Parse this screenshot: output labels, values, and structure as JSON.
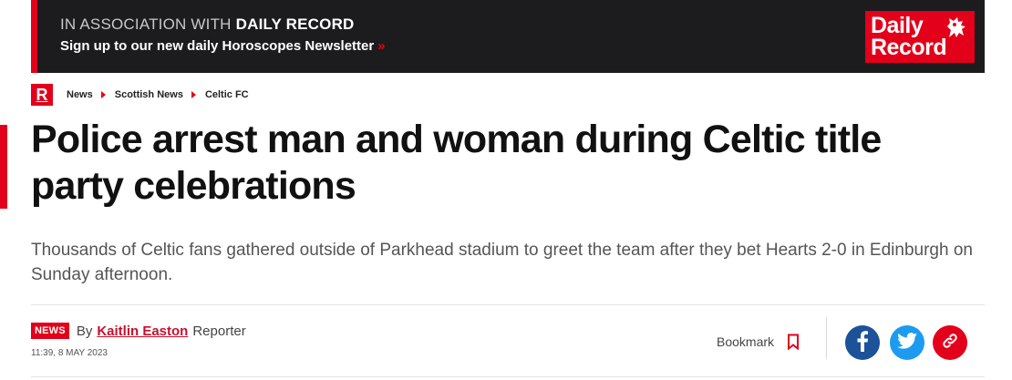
{
  "colors": {
    "brand_red": "#e2001a",
    "promo_bg": "#1c1c1e",
    "facebook": "#1b5298",
    "twitter": "#1d9bf0"
  },
  "promo": {
    "association_prefix": "IN ASSOCIATION WITH",
    "association_brand": "DAILY RECORD",
    "newsletter_link": "Sign up to our new daily Horoscopes Newsletter",
    "arrows": "»"
  },
  "logo": {
    "line1": "Daily",
    "line2": "Record",
    "crest_icon": "lion-rampant-icon"
  },
  "breadcrumb": {
    "site_icon_letter": "R",
    "items": [
      "News",
      "Scottish News",
      "Celtic FC"
    ]
  },
  "article": {
    "headline": "Police arrest man and woman during Celtic title party celebrations",
    "standfirst": "Thousands of Celtic fans gathered outside of Parkhead stadium to greet the team after they bet Hearts 2-0 in Edinburgh on Sunday afternoon."
  },
  "byline": {
    "badge": "NEWS",
    "by": "By",
    "author": "Kaitlin Easton",
    "role": "Reporter",
    "timestamp": "11:39, 8 MAY 2023"
  },
  "actions": {
    "bookmark_label": "Bookmark",
    "bookmark_icon": "bookmark-icon",
    "share_icons": [
      "facebook-icon",
      "twitter-icon",
      "link-icon"
    ]
  }
}
